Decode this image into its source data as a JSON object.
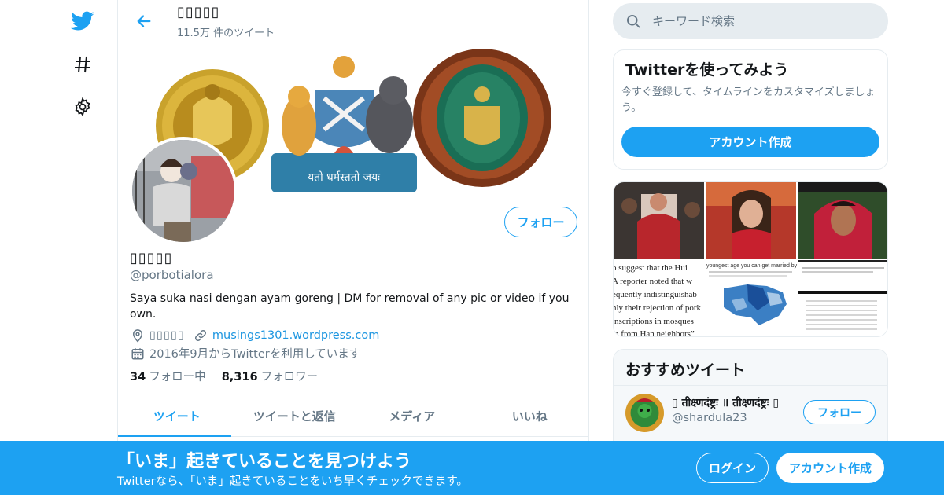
{
  "nav": {
    "icons": [
      "twitter-logo-icon",
      "hashtag-icon",
      "gear-icon"
    ],
    "brand_color": "#1da1f2"
  },
  "header": {
    "name": "▯▯▯▯▯",
    "tweet_count": "11.5万 件のツイート"
  },
  "profile": {
    "name": "▯▯▯▯▯",
    "handle": "@porbotialora",
    "bio": "Saya suka nasi dengan ayam goreng | DM for removal of any pic or video if you own.",
    "location": "▯▯▯▯▯",
    "website": "musings1301.wordpress.com",
    "joined": "2016年9月からTwitterを利用しています",
    "following_count": "34",
    "following_label": "フォロー中",
    "followers_count": "8,316",
    "followers_label": "フォロワー",
    "follow_button": "フォロー",
    "banner_motto": "यतो धर्मस्ततो जयः"
  },
  "tabs": [
    {
      "label": "ツイート",
      "active": true
    },
    {
      "label": "ツイートと返信",
      "active": false
    },
    {
      "label": "メディア",
      "active": false
    },
    {
      "label": "いいね",
      "active": false
    }
  ],
  "search": {
    "placeholder": "キーワード検索"
  },
  "signup_card": {
    "title": "Twitterを使ってみよう",
    "description": "今すぐ登録して、タイムラインをカスタマイズしましょう。",
    "button": "アカウント作成"
  },
  "media_card": {
    "tiles": [
      {
        "caption": "",
        "text": ""
      },
      {
        "caption": "",
        "text": ""
      },
      {
        "caption": "",
        "text": ""
      },
      {
        "caption": "quote",
        "text": "o suggest that the Hui\n A reporter noted that w\nequently indistinguishab\nnly their rejection of pork\ninscriptions in mosques\nm from Han neighbors”"
      },
      {
        "caption": "map",
        "text": "youngest age you can get married by sta"
      },
      {
        "caption": "table",
        "text": ""
      }
    ]
  },
  "recommended": {
    "title": "おすすめツイート",
    "items": [
      {
        "name": "▯ तीक्ष्णदंष्ट्रः ॥ तीक्ष्णदंष्ट्रः ▯",
        "handle": "@shardula23",
        "follow_label": "フォロー"
      }
    ]
  },
  "bottom_bar": {
    "title": "「いま」起きていることを見つけよう",
    "subtitle": "Twitterなら、「いま」起きていることをいち早くチェックできます。",
    "login": "ログイン",
    "signup": "アカウント作成"
  }
}
